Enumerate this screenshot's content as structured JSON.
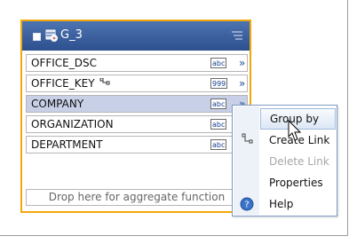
{
  "group": {
    "title": "G_3",
    "fields": [
      {
        "label": "OFFICE_DSC",
        "type_badge": "abc",
        "key": false
      },
      {
        "label": "OFFICE_KEY",
        "type_badge": "999",
        "key": true
      },
      {
        "label": "COMPANY",
        "type_badge": "abc",
        "key": false,
        "selected": true
      },
      {
        "label": "ORGANIZATION",
        "type_badge": "abc",
        "key": false
      },
      {
        "label": "DEPARTMENT",
        "type_badge": "abc",
        "key": false
      }
    ],
    "drop_zone_text": "Drop here for aggregate function",
    "expand_glyph": "»"
  },
  "context_menu": {
    "items": [
      {
        "label": "Group by",
        "state": "hover",
        "icon": null
      },
      {
        "label": "Create Link",
        "state": "normal",
        "icon": "link-icon"
      },
      {
        "label": "Delete Link",
        "state": "disabled",
        "icon": null
      },
      {
        "label": "Properties",
        "state": "normal",
        "icon": null
      },
      {
        "label": "Help",
        "state": "normal",
        "icon": "help-icon"
      }
    ]
  },
  "colors": {
    "header_bg": "#3a5f9f",
    "selection_outline": "#f3a70a",
    "selected_row_bg": "#c8d0e7",
    "menu_hover": "#dce7f5"
  }
}
